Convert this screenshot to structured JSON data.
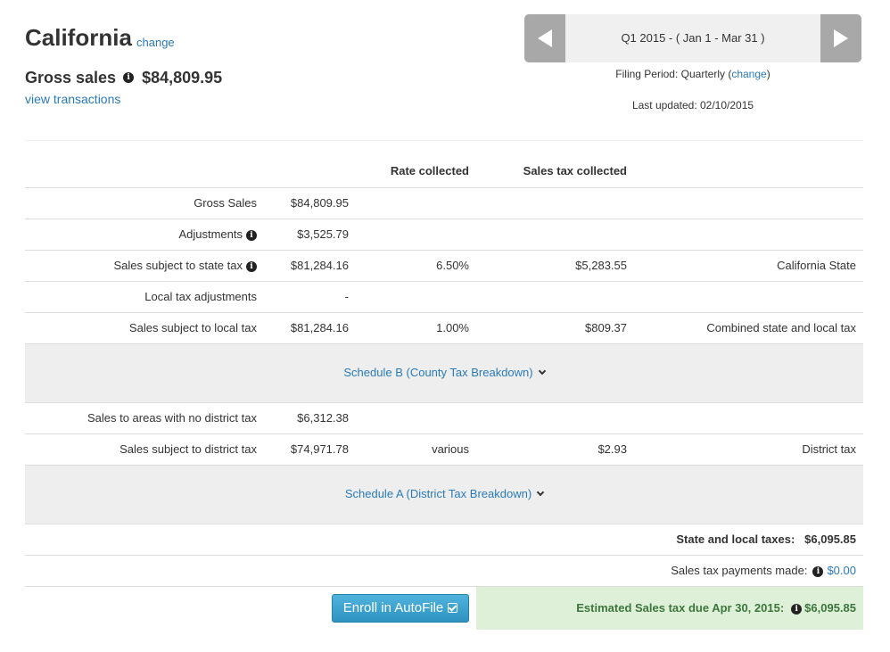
{
  "header": {
    "state": "California",
    "change_label": "change",
    "gross_sales_label": "Gross sales",
    "gross_sales_value": "$84,809.95",
    "view_transactions_label": "view transactions"
  },
  "period": {
    "label": "Q1 2015 - ( Jan 1 - Mar 31 )",
    "filing_period_prefix": "Filing Period: Quarterly (",
    "filing_change_label": "change",
    "filing_period_suffix": ")",
    "last_updated": "Last updated: 02/10/2015"
  },
  "table": {
    "headers": {
      "rate": "Rate collected",
      "tax": "Sales tax collected"
    },
    "rows": [
      {
        "label": "Gross Sales",
        "amount": "$84,809.95",
        "rate": "",
        "tax": "",
        "jurisdiction": ""
      },
      {
        "label": "Adjustments",
        "amount": "$3,525.79",
        "rate": "",
        "tax": "",
        "jurisdiction": ""
      },
      {
        "label": "Sales subject to state tax",
        "amount": "$81,284.16",
        "rate": "6.50%",
        "tax": "$5,283.55",
        "jurisdiction": "California State"
      },
      {
        "label": "Local tax adjustments",
        "amount": "-",
        "rate": "",
        "tax": "",
        "jurisdiction": ""
      },
      {
        "label": "Sales subject to local tax",
        "amount": "$81,284.16",
        "rate": "1.00%",
        "tax": "$809.37",
        "jurisdiction": "Combined state and local tax"
      },
      {
        "label": "Sales to areas with no district tax",
        "amount": "$6,312.38",
        "rate": "",
        "tax": "",
        "jurisdiction": ""
      },
      {
        "label": "Sales subject to district tax",
        "amount": "$74,971.78",
        "rate": "various",
        "tax": "$2.93",
        "jurisdiction": "District tax"
      }
    ],
    "schedule_b": "Schedule B (County Tax Breakdown)",
    "schedule_a": "Schedule A (District Tax Breakdown)"
  },
  "summary": {
    "state_local_label": "State and local taxes:",
    "state_local_value": "$6,095.85",
    "payments_label": "Sales tax payments made:",
    "payments_value": "$0.00"
  },
  "footer": {
    "autofile_label": "Enroll in AutoFile",
    "estimated_label": "Estimated Sales tax due Apr 30, 2015:",
    "estimated_value": "$6,095.85"
  },
  "colors": {
    "link": "#2a7ab8",
    "nav_button": "#a8a8a8",
    "autofile_button": "#3aa1cf",
    "estimated_bg": "#dff0d8",
    "estimated_text": "#3c763d"
  },
  "icons": [
    "info-icon",
    "prev-arrow-icon",
    "next-arrow-icon",
    "chevron-down-icon",
    "checkbox-check-icon"
  ]
}
